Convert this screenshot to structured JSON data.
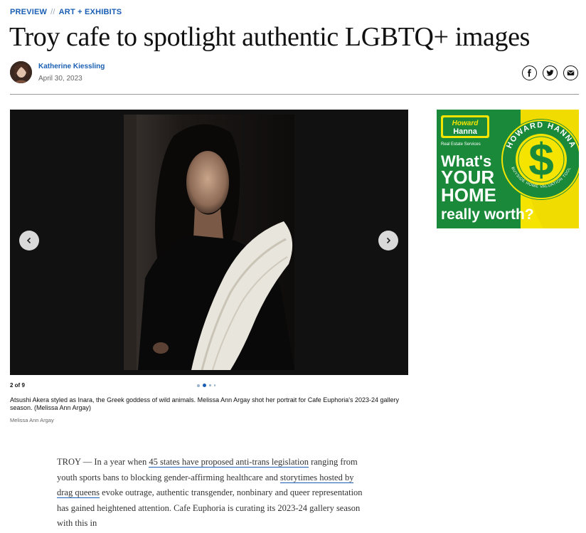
{
  "breadcrumb": {
    "section": "PREVIEW",
    "separator": "//",
    "subsection": "ART + EXHIBITS"
  },
  "article": {
    "headline": "Troy cafe to spotlight authentic LGBTQ+ images",
    "author": "Katherine Kiessling",
    "date": "April 30, 2023"
  },
  "share": {
    "icons": [
      "facebook-icon",
      "twitter-icon",
      "email-icon"
    ]
  },
  "gallery": {
    "counter": "2 of 9",
    "caption": "Atsushi Akera styled as Inara, the Greek goddess of wild animals. Melissa Ann Argay shot her portrait for Cafe Euphoria's 2023-24 gallery season. (Melissa Ann Argay)",
    "credit": "Melissa Ann Argay",
    "prev_icon": "chevron-left-icon",
    "next_icon": "chevron-right-icon"
  },
  "ad": {
    "brand_top": "Howard",
    "brand_bottom": "Hanna",
    "brand_sub": "Real Estate Services",
    "badge_ring_top": "HOWARD HANNA",
    "badge_ring_bottom": "BUYSIDE HOME VALUATION TOOL",
    "headline_line1": "What's",
    "headline_line2": "YOUR",
    "headline_line3": "HOME",
    "headline_line4": "really worth?",
    "colors": {
      "green": "#1a8a3a",
      "yellow": "#f5e400"
    }
  },
  "body": {
    "p1_a": "TROY — In a year when ",
    "p1_link1": "45 states have proposed anti-trans legislation",
    "p1_b": " ranging from youth sports bans to blocking gender-affirming healthcare and ",
    "p1_link2": "storytimes hosted by drag queens",
    "p1_c": " evoke outrage, authentic transgender, nonbinary and queer representation has gained heightened attention. Cafe Euphoria is curating its 2023-24 gallery season with this in"
  },
  "colors": {
    "link": "#1a5fb4",
    "rule": "#9a9a9a"
  }
}
